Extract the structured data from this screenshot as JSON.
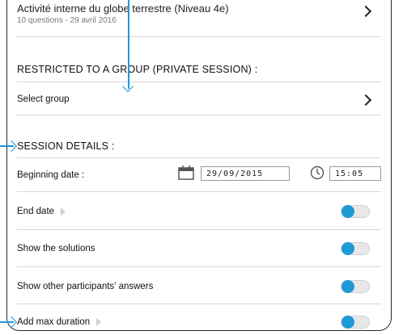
{
  "quiz": {
    "title": "Activité interne du globe terrestre (Niveau 4e)",
    "subtitle": "10 questions - 29 avril 2016"
  },
  "restricted": {
    "heading": "RESTRICTED TO A GROUP (PRIVATE SESSION) :",
    "select_group_label": "Select group"
  },
  "session": {
    "heading": "SESSION DETAILS :",
    "beginning_label": "Beginning date :",
    "date_value": "29/09/2015",
    "time_value": "15:05",
    "end_date_label": "End date",
    "show_solutions_label": "Show the solutions",
    "show_others_label": "Show other participants' answers",
    "max_duration_label": "Add max duration"
  },
  "toggles": {
    "end_date": false,
    "show_solutions": false,
    "show_others": false,
    "max_duration": false
  },
  "colors": {
    "accent": "#1e9ad6"
  }
}
